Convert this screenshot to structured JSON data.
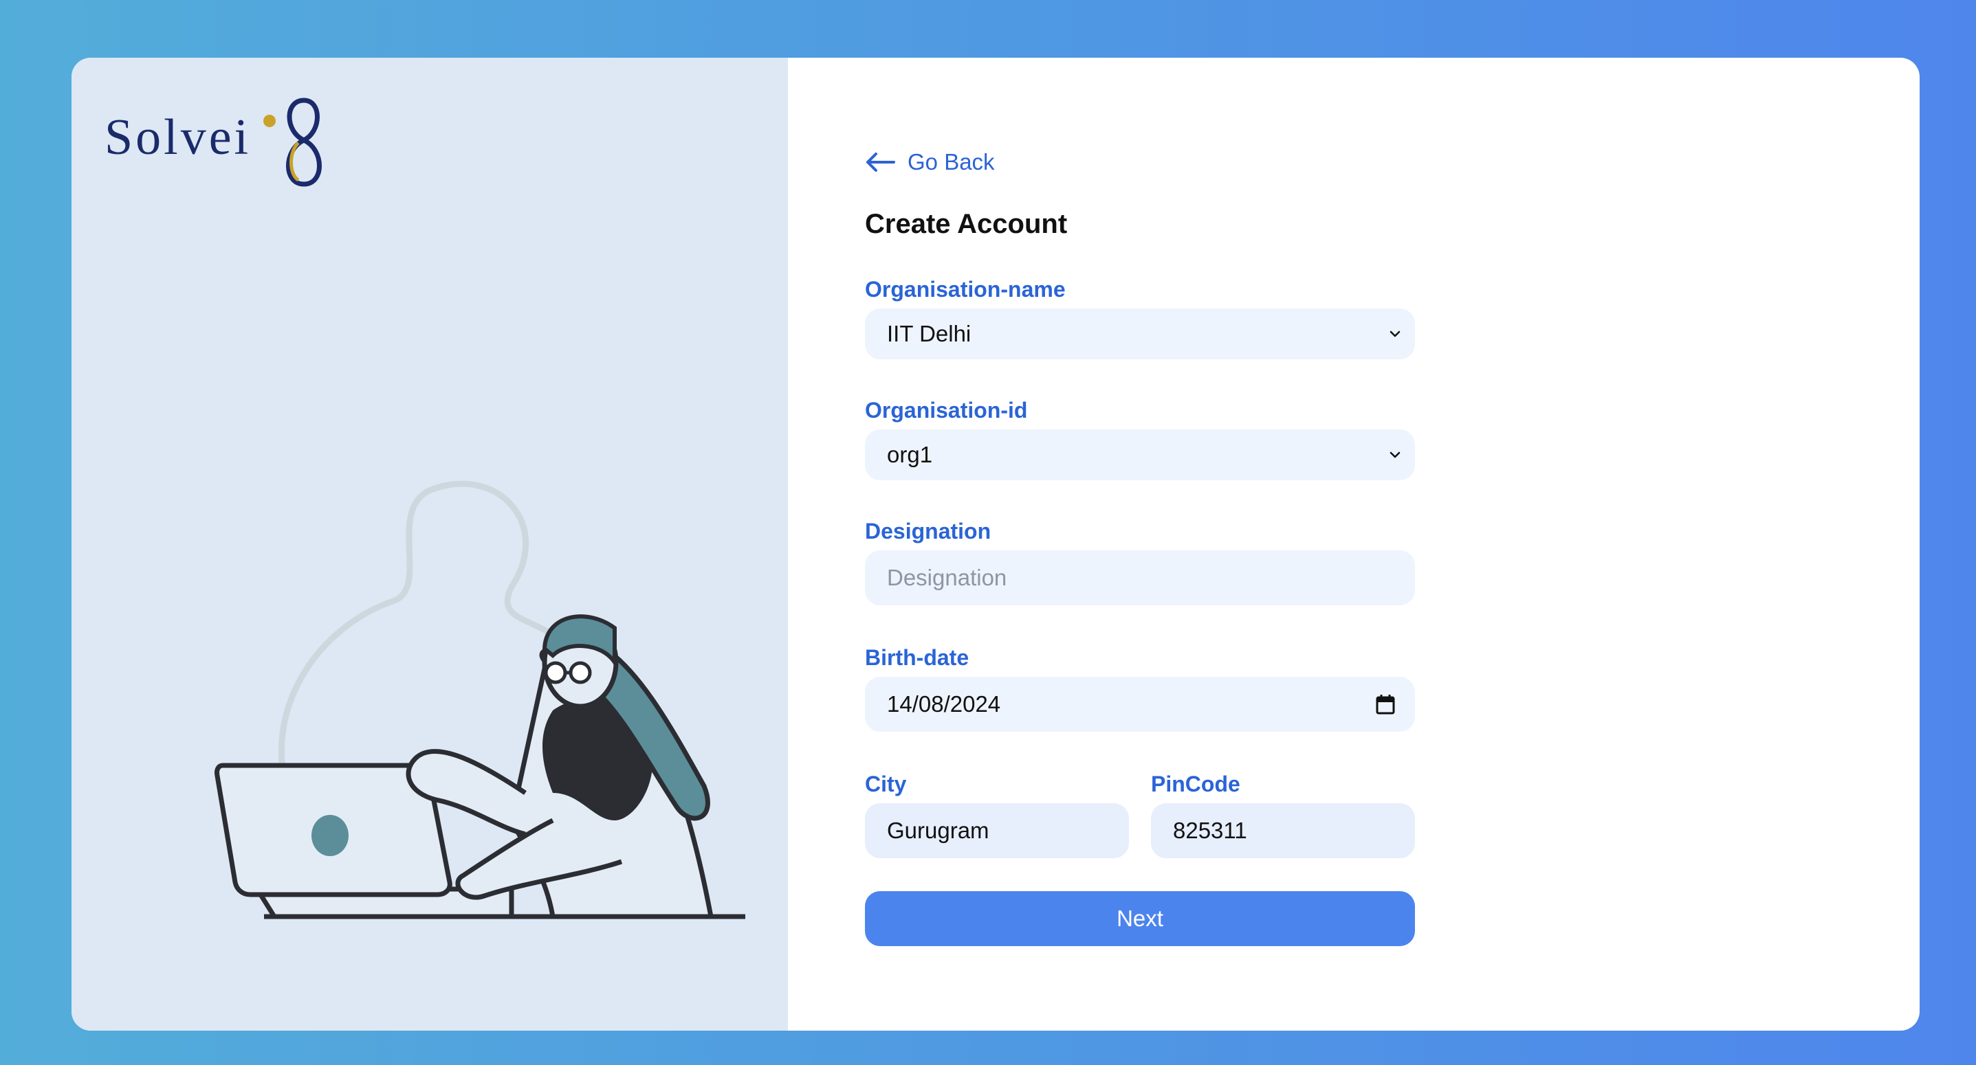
{
  "brand": {
    "logo_text": "Solvei",
    "logo_mark": "8"
  },
  "nav": {
    "back_label": "Go Back"
  },
  "form": {
    "title": "Create Account",
    "organisation_name": {
      "label": "Organisation-name",
      "value": "IIT Delhi"
    },
    "organisation_id": {
      "label": "Organisation-id",
      "value": "org1"
    },
    "designation": {
      "label": "Designation",
      "placeholder": "Designation",
      "value": ""
    },
    "birth_date": {
      "label": "Birth-date",
      "value": "14/08/2024"
    },
    "city": {
      "label": "City",
      "value": "Gurugram"
    },
    "pincode": {
      "label": "PinCode",
      "value": "825311"
    },
    "next_label": "Next"
  },
  "colors": {
    "accent": "#4c84ee",
    "label": "#2a64d6",
    "left_panel": "#dde8f4",
    "field_bg": "#eef4fd"
  },
  "icons": [
    "arrow-left-icon",
    "chevron-down-icon",
    "calendar-icon"
  ]
}
